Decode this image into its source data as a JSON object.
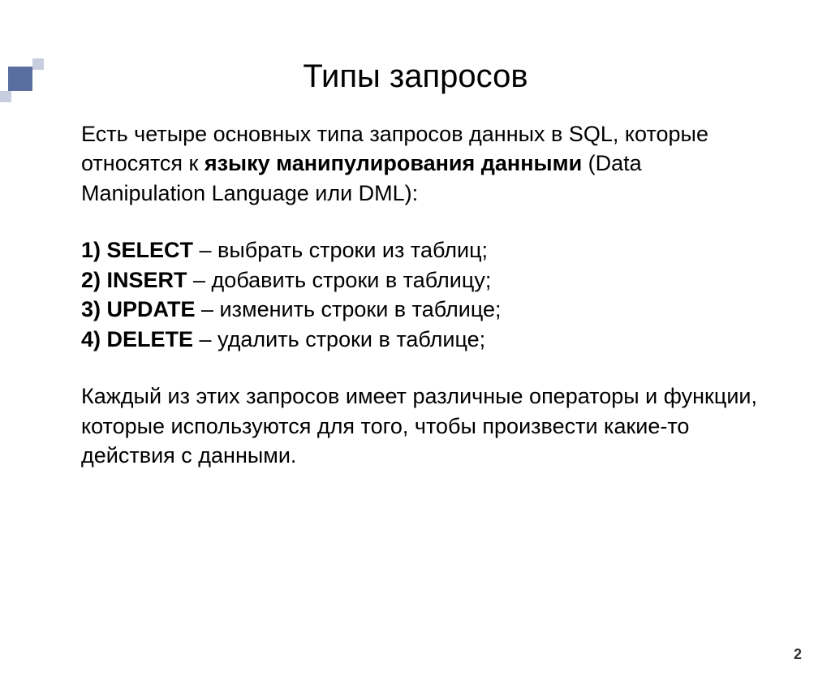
{
  "title": "Типы запросов",
  "intro": {
    "part1": "Есть четыре основных типа запросов данных в SQL, которые относятся к ",
    "bold": "языку манипулирования данными",
    "part2": " (Data Manipulation Language или DML):"
  },
  "items": [
    {
      "num": "1) ",
      "cmd": "SELECT",
      "desc": " – выбрать строки из таблиц;"
    },
    {
      "num": "2) ",
      "cmd": "INSERT",
      "desc": " – добавить строки в таблицу;"
    },
    {
      "num": "3) ",
      "cmd": "UPDATE",
      "desc": " – изменить строки в таблице;"
    },
    {
      "num": "4) ",
      "cmd": "DELETE",
      "desc": " – удалить строки в таблице;"
    }
  ],
  "outro": "Каждый из этих запросов имеет различные операторы и функции, которые используются для того, чтобы произвести какие-то действия с данными.",
  "page_number": "2"
}
